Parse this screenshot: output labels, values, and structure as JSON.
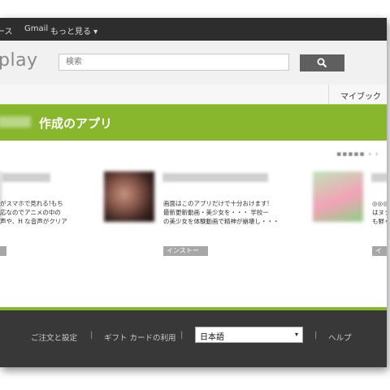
{
  "topbar": {
    "items": [
      "ース",
      "Gmail",
      "もっと見る ▾"
    ]
  },
  "header": {
    "logo": "play",
    "search_placeholder": "検索"
  },
  "nav": {
    "mybook": "マイブック"
  },
  "banner": {
    "title": "作成のアプリ"
  },
  "apps": [
    {
      "desc": [
        "がスマホで見れる!もち",
        "応なのでアニメの中の",
        "声や、H な音声がクリア"
      ],
      "install": ""
    },
    {
      "desc": [
        "画面はこのアプリだけで十分おけます!",
        "最新更新動画・美少女を・・・ 学校ー",
        "の美少女を体験動画で精神が崩壊し・・・"
      ],
      "install": "インストール"
    },
    {
      "desc": [
        "◎◎◎◎の",
        "はヌクの",
        "も鮮くこ"
      ],
      "install": "イ"
    }
  ],
  "footer": {
    "orders": "ご注文と設定",
    "gift": "ギフト カードの利用",
    "help": "ヘルプ",
    "separator": "|",
    "language": "日本語",
    "dropdown_arrow": "▾"
  },
  "colors": {
    "accent": "#88b62d",
    "topbar": "#2d2d2d",
    "footer": "#383838"
  }
}
